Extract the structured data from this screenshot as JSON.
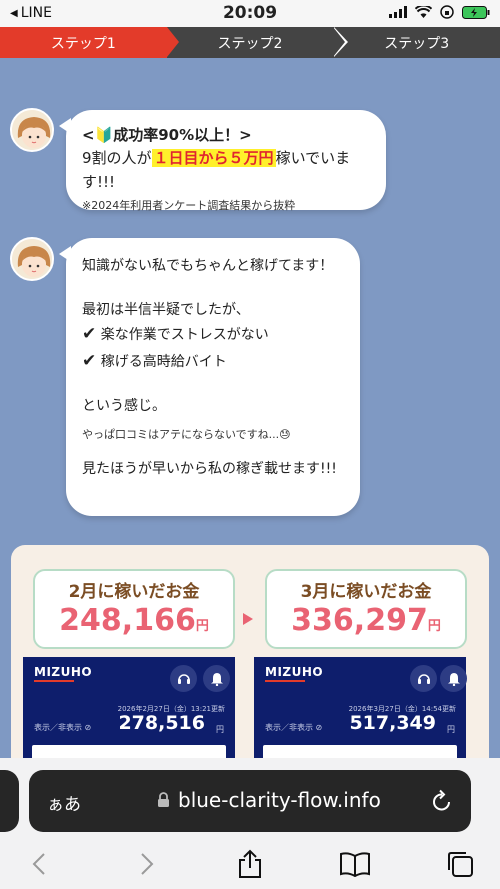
{
  "status_bar": {
    "back_app": "LINE",
    "time": "20:09"
  },
  "steps": [
    "ステップ1",
    "ステップ2",
    "ステップ3"
  ],
  "chat": {
    "bubble1": {
      "headline": "<🔰成功率90%以上！>",
      "line_pre": "9割の人が",
      "highlight": "１日目から５万円",
      "line_post": "稼いでいます!!!",
      "note": "※2024年利用者ンケート調査結果から抜粋"
    },
    "bubble2": {
      "line1": "知識がない私でもちゃんと稼げてます！",
      "line2": "最初は半信半疑でしたが、",
      "check_mark": "✔",
      "check1": "楽な作業でストレスがない",
      "check2": "稼げる高時給バイト",
      "line3": "という感じ。",
      "line4": "やっぱ口コミはアテにならないですね...😓",
      "line5": "見たほうが早いから私の稼ぎ載せます!!!"
    }
  },
  "earnings": {
    "feb": {
      "title": "2月に稼いだお金",
      "amount": "248,166",
      "unit": "円"
    },
    "mar": {
      "title": "3月に稼いだお金",
      "amount": "336,297",
      "unit": "円"
    },
    "bank_feb": {
      "logo": "MIZUHO",
      "timestamp": "2026年2月27日（金）13:21更新",
      "visibility": "表示／非表示",
      "balance": "278,516",
      "unit": "円"
    },
    "bank_mar": {
      "logo": "MIZUHO",
      "timestamp": "2026年3月27日（金）14:54更新",
      "visibility": "表示／非表示",
      "balance": "517,349",
      "unit": "円"
    }
  },
  "browser": {
    "text_size_label": "ぁあ",
    "host": "blue-clarity-flow.info",
    "icons": [
      "back-icon",
      "forward-icon",
      "share-icon",
      "bookmarks-icon",
      "tabs-icon",
      "reload-icon",
      "lock-icon"
    ]
  },
  "colors": {
    "step_active": "#e33b2a",
    "step_inactive": "#444444",
    "background": "#7f99c3",
    "amount_pink": "#e96373",
    "bank_navy": "#0e1e6c"
  }
}
